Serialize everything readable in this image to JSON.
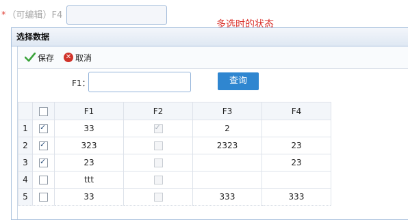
{
  "form": {
    "required_mark": "*",
    "field_label": "（可编辑）F4",
    "annotation": "多选时的状态"
  },
  "dialog": {
    "title": "选择数据",
    "toolbar": {
      "save_label": "保存",
      "cancel_label": "取消"
    },
    "search": {
      "label": "F1：",
      "value": "",
      "button_label": "查询"
    }
  },
  "table": {
    "columns": [
      "F1",
      "F2",
      "F3",
      "F4"
    ],
    "rows": [
      {
        "num": "1",
        "selected": true,
        "f1": "33",
        "f2_checked": true,
        "f3": "2",
        "f4": ""
      },
      {
        "num": "2",
        "selected": true,
        "f1": "323",
        "f2_checked": false,
        "f3": "2323",
        "f4": "23"
      },
      {
        "num": "3",
        "selected": true,
        "f1": "23",
        "f2_checked": false,
        "f3": "",
        "f4": "23"
      },
      {
        "num": "4",
        "selected": false,
        "f1": "ttt",
        "f2_checked": false,
        "f3": "",
        "f4": ""
      },
      {
        "num": "5",
        "selected": false,
        "f1": "33",
        "f2_checked": false,
        "f3": "333",
        "f4": "333"
      }
    ]
  },
  "icons": {
    "save": "checkmark-icon",
    "cancel": "cancel-circle-icon"
  },
  "colors": {
    "accent": "#2f86d0",
    "annotation": "#d9302a",
    "border": "#a9c1dd",
    "save_icon": "#3aa33a",
    "cancel_icon": "#d0332a"
  }
}
